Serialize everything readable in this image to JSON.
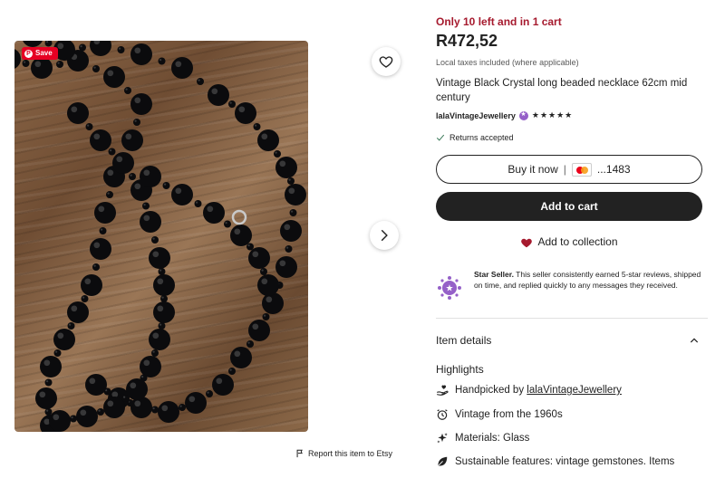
{
  "media": {
    "save_label": "Save",
    "report_label": "Report this item to Etsy"
  },
  "listing": {
    "stock_notice": "Only 10 left and in 1 cart",
    "price": "R472,52",
    "tax_note": "Local taxes included (where applicable)",
    "title": "Vintage Black Crystal long beaded necklace 62cm mid century",
    "shop_name": "lalaVintageJewellery",
    "rating_stars": "★★★★★",
    "rating_value": 5,
    "returns": "Returns accepted"
  },
  "actions": {
    "buy_now_label": "Buy it now",
    "buy_separator": "|",
    "card_suffix": "...1483",
    "add_to_cart_label": "Add to cart",
    "add_to_collection_label": "Add to collection"
  },
  "star_seller": {
    "heading": "Star Seller.",
    "text": " This seller consistently earned 5-star reviews, shipped on time, and replied quickly to any messages they received."
  },
  "item_details": {
    "heading": "Item details",
    "highlights_heading": "Highlights",
    "highlights": [
      {
        "icon": "hand-heart-icon",
        "prefix": "Handpicked by ",
        "value": "lalaVintageJewellery"
      },
      {
        "icon": "alarm-clock-icon",
        "prefix": "Vintage from the 1960s",
        "value": ""
      },
      {
        "icon": "sparkle-icon",
        "prefix": "Materials: Glass",
        "value": ""
      },
      {
        "icon": "leaf-icon",
        "prefix": "Sustainable features: vintage gemstones. Items",
        "value": ""
      }
    ]
  },
  "colors": {
    "stock_red": "#a61a2e",
    "primary_button": "#222222",
    "star_seller_purple": "#9560c8",
    "pinterest_red": "#e60023"
  }
}
